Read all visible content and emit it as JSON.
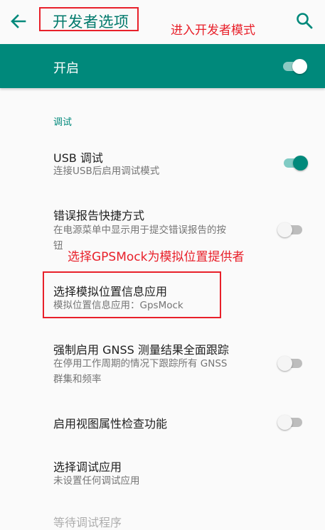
{
  "toolbar": {
    "back_icon": "arrow-back-icon",
    "title": "开发者选项",
    "search_icon": "search-icon"
  },
  "annotations": {
    "enter_mode": "进入开发者模式",
    "choose_mock": "选择GPSMock为模拟位置提供者"
  },
  "master": {
    "label": "开启",
    "enabled": true
  },
  "section": {
    "header": "调试"
  },
  "prefs": [
    {
      "title": "USB 调试",
      "summary": "连接USB后启用调试模式",
      "switch": "on"
    },
    {
      "title": "错误报告快捷方式",
      "summary_line1": "在电源菜单中显示用于提交错误报告的按",
      "summary_line2": "钮",
      "switch": "off"
    },
    {
      "title": "选择模拟位置信息应用",
      "summary": "模拟位置信息应用：GpsMock"
    },
    {
      "title": "强制启用 GNSS 测量结果全面跟踪",
      "summary_line1": "在停用工作周期的情况下跟踪所有 GNSS",
      "summary_line2": "群集和频率",
      "switch": "off"
    },
    {
      "title": "启用视图属性检查功能",
      "switch": "off"
    },
    {
      "title": "选择调试应用",
      "summary": "未设置任何调试应用"
    },
    {
      "title": "等待调试程序"
    }
  ],
  "colors": {
    "accent": "#00897b",
    "annotation": "#e8202a"
  }
}
